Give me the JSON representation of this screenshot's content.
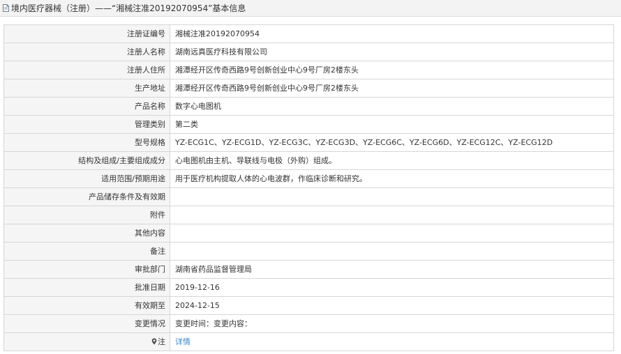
{
  "header": {
    "title": "境内医疗器械（注册）——“湘械注准20192070954”基本信息",
    "icon": "document-icon"
  },
  "rows": [
    {
      "label": "注册证编号",
      "value": "湘械注准20192070954"
    },
    {
      "label": "注册人名称",
      "value": "湖南远真医疗科技有限公司"
    },
    {
      "label": "注册人住所",
      "value": "湘潭经开区传奇西路9号创新创业中心9号厂房2楼东头"
    },
    {
      "label": "生产地址",
      "value": "湘潭经开区传奇西路9号创新创业中心9号厂房2楼东头"
    },
    {
      "label": "产品名称",
      "value": "数字心电图机"
    },
    {
      "label": "管理类别",
      "value": "第二类"
    },
    {
      "label": "型号规格",
      "value": "YZ-ECG1C、YZ-ECG1D、YZ-ECG3C、YZ-ECG3D、YZ-ECG6C、YZ-ECG6D、YZ-ECG12C、YZ-ECG12D"
    },
    {
      "label": "结构及组成/主要组成成分",
      "value": "心电图机由主机、导联线与电极（外购）组成。"
    },
    {
      "label": "适用范围/预期用途",
      "value": "用于医疗机构提取人体的心电波群，作临床诊断和研究。"
    },
    {
      "label": "产品储存条件及有效期",
      "value": ""
    },
    {
      "label": "附件",
      "value": ""
    },
    {
      "label": "其他内容",
      "value": ""
    },
    {
      "label": "备注",
      "value": ""
    },
    {
      "label": "审批部门",
      "value": "湖南省药品监督管理局"
    },
    {
      "label": "批准日期",
      "value": "2019-12-16"
    },
    {
      "label": "有效期至",
      "value": "2024-12-15"
    },
    {
      "label": "变更情况",
      "value": "变更时间：变更内容："
    }
  ],
  "note_row": {
    "label": "注",
    "icon": "map-pin-icon",
    "link_text": "详情"
  },
  "colors": {
    "label_bg": "#f5f5f5",
    "border": "#d6d6d6",
    "link": "#3c89c8",
    "title_bg": "#f3f3f3"
  }
}
